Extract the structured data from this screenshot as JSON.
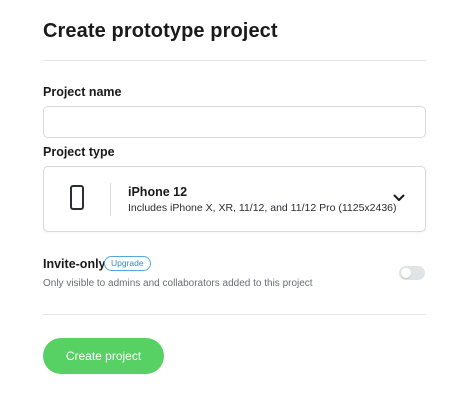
{
  "page": {
    "title": "Create prototype project"
  },
  "project_name": {
    "label": "Project name",
    "value": "",
    "placeholder": ""
  },
  "project_type": {
    "label": "Project type",
    "selected": {
      "icon": "phone-icon",
      "name": "iPhone 12",
      "description": "Includes iPhone X, XR, 11/12, and 11/12 Pro (1125x2436)"
    },
    "chevron_icon": "chevron-down-icon"
  },
  "invite_only": {
    "label": "Invite-only",
    "badge": "Upgrade",
    "description": "Only visible to admins and collaborators added to this project",
    "enabled": false
  },
  "actions": {
    "create_label": "Create project"
  },
  "colors": {
    "primary_button": "#57d163",
    "badge": "#2b8ccc",
    "toggle_off": "#e1e3e6"
  }
}
